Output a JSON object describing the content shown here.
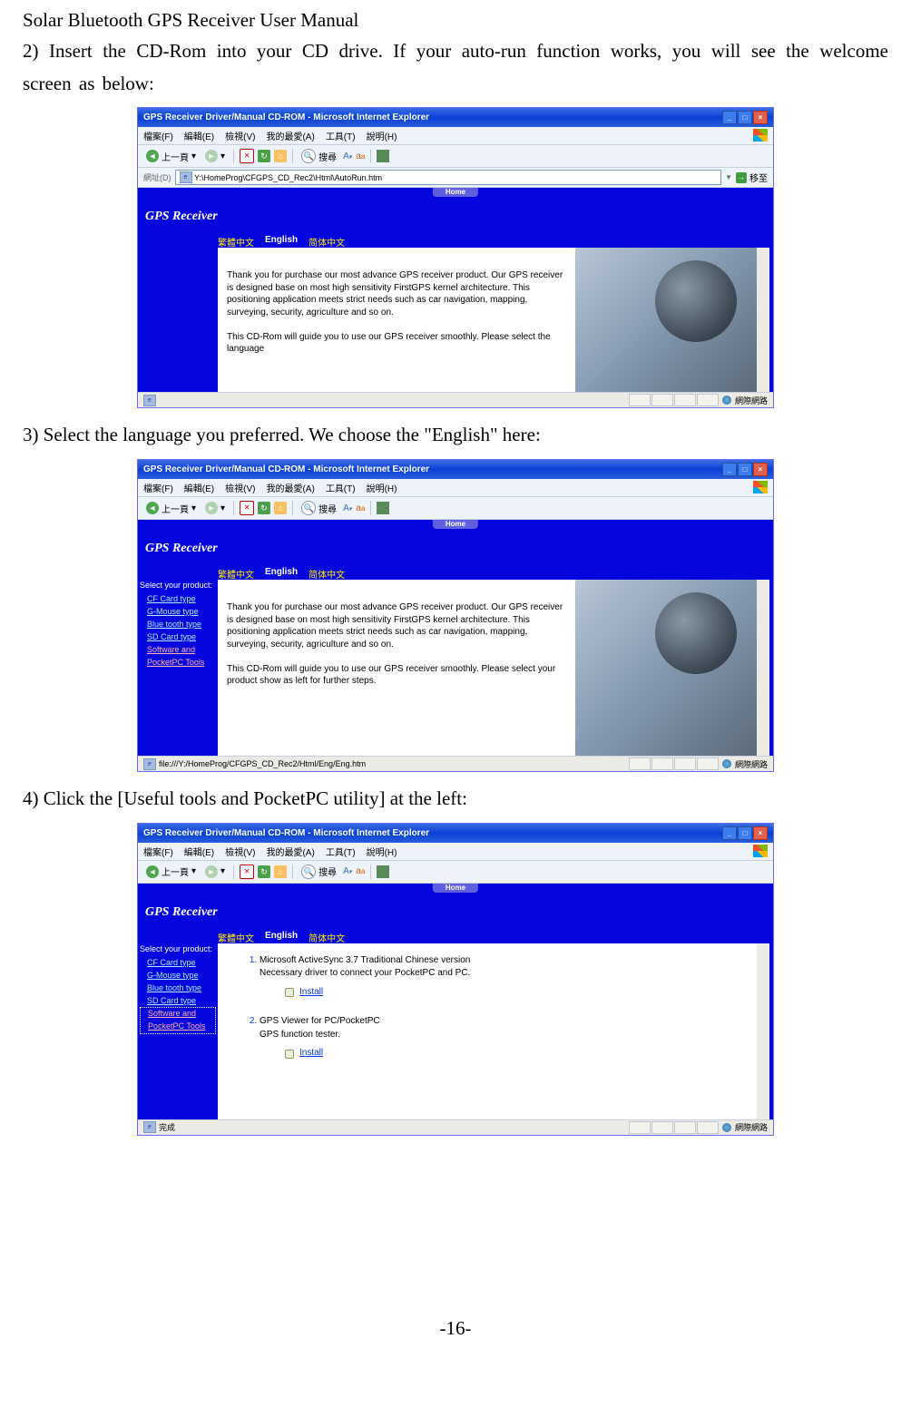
{
  "doc_title": "Solar Bluetooth GPS Receiver User Manual",
  "step2": "2) Insert the CD-Rom into your CD drive. If your auto-run function works, you will see the welcome screen as below:",
  "step3": "3) Select the language you preferred. We choose the \"English\" here:",
  "step4": "4) Click the [Useful tools and PocketPC utility] at the left:",
  "page_number": "-16-",
  "ie": {
    "title": "GPS Receiver Driver/Manual CD-ROM - Microsoft Internet Explorer",
    "menu": {
      "file": "檔案(F)",
      "edit": "編輯(E)",
      "view": "檢視(V)",
      "fav": "我的最愛(A)",
      "tools": "工具(T)",
      "help": "說明(H)"
    },
    "tb": {
      "back": "上一頁",
      "search": "搜尋"
    },
    "addr_label": "網址(D)",
    "addr1": "Y:\\HomeProg\\CFGPS_CD_Rec2\\Html\\AutoRun.htm",
    "addr2": "file:///Y:/HomeProg/CFGPS_CD_Rec2/Html/Eng/Eng.htm",
    "go": "移至",
    "status_zone": "網際網路",
    "status_done": "完成"
  },
  "page": {
    "home": "Home",
    "brand": "GPS Receiver",
    "lang": {
      "zh_tw": "繁體中文",
      "en": "English",
      "zh_cn": "简体中文"
    },
    "para1": "Thank you for purchase our most advance GPS receiver product. Our GPS receiver is designed base on most high sensitivity FirstGPS kernel architecture. This positioning application meets strict needs such as car navigation, mapping, surveying, security, agriculture and so on.",
    "para2a": "This CD-Rom will guide you to use our GPS receiver smoothly. Please select the language",
    "para2b": "This CD-Rom will guide you to use our GPS receiver smoothly. Please select your product show as left for further steps.",
    "sidebar": {
      "header": "Select your product:",
      "items": [
        "CF Card type",
        "G-Mouse type",
        "Blue tooth type",
        "SD Card type",
        "Software and PocketPC Tools"
      ]
    },
    "tools": {
      "item1_l1": "Microsoft ActiveSync 3.7 Traditional Chinese version",
      "item1_l2": "Necessary driver to connect your PocketPC and PC.",
      "item2_l1": "GPS Viewer for PC/PocketPC",
      "item2_l2": "GPS function tester.",
      "install": "Install"
    }
  }
}
